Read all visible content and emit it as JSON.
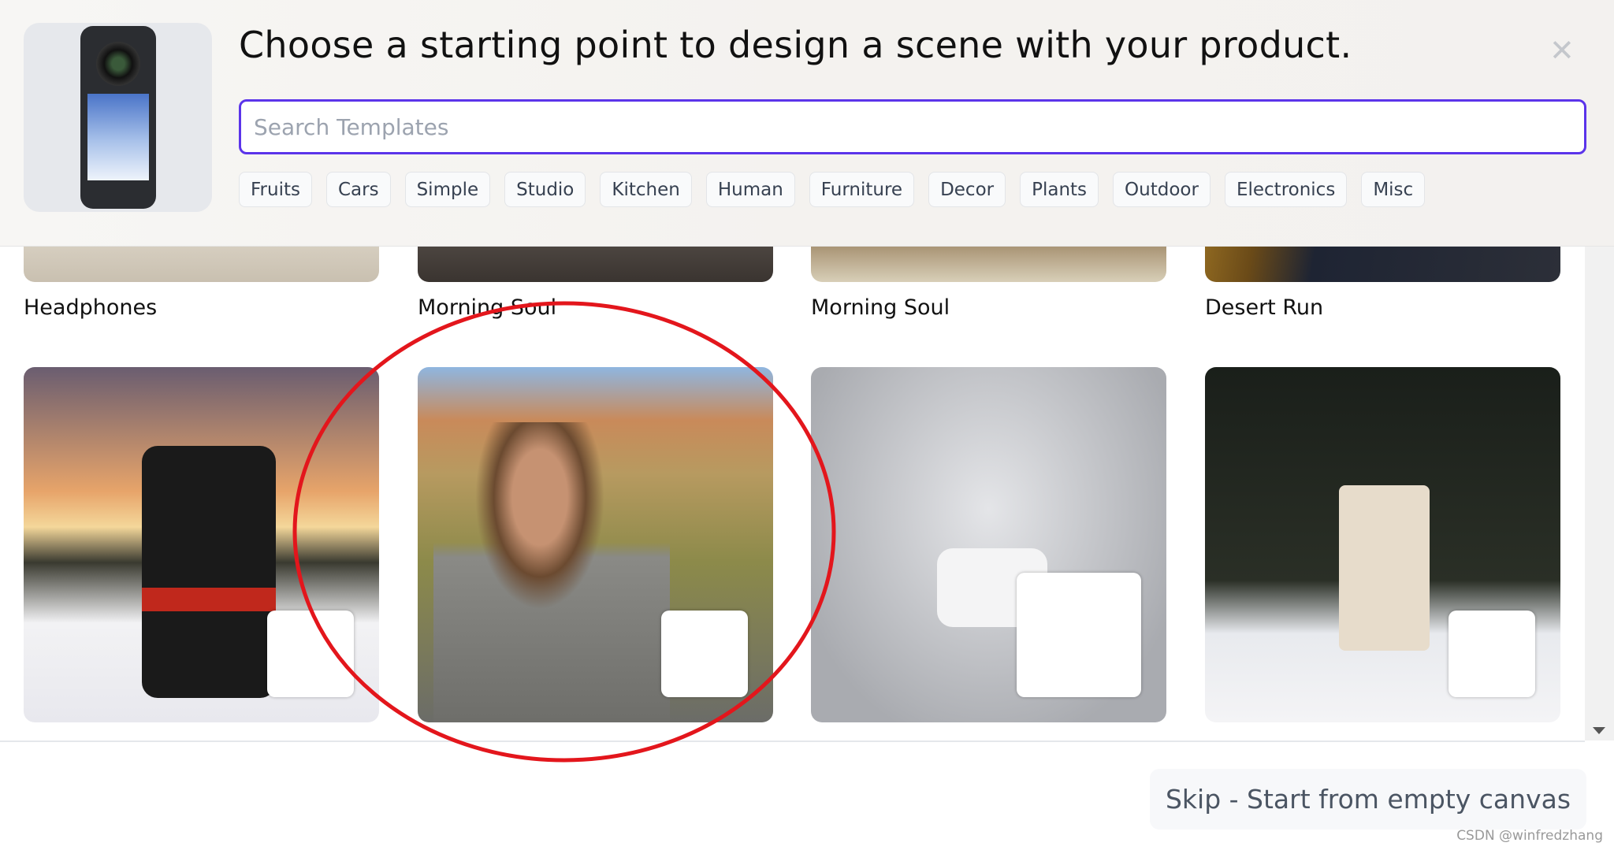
{
  "header": {
    "title": "Choose a starting point to design a scene with your product.",
    "close_icon": "close-icon"
  },
  "search": {
    "placeholder": "Search Templates",
    "value": ""
  },
  "categories": [
    "Fruits",
    "Cars",
    "Simple",
    "Studio",
    "Kitchen",
    "Human",
    "Furniture",
    "Decor",
    "Plants",
    "Outdoor",
    "Electronics",
    "Misc"
  ],
  "templates_row1": [
    {
      "label": "Headphones"
    },
    {
      "label": "Morning Soul"
    },
    {
      "label": "Morning Soul"
    },
    {
      "label": "Desert Run"
    }
  ],
  "footer": {
    "skip_label": "Skip - Start from empty canvas"
  },
  "watermark": "CSDN @winfredzhang",
  "annotation": {
    "color": "#e3161c",
    "shape": "ellipse"
  },
  "colors": {
    "accent": "#5b34ea"
  }
}
